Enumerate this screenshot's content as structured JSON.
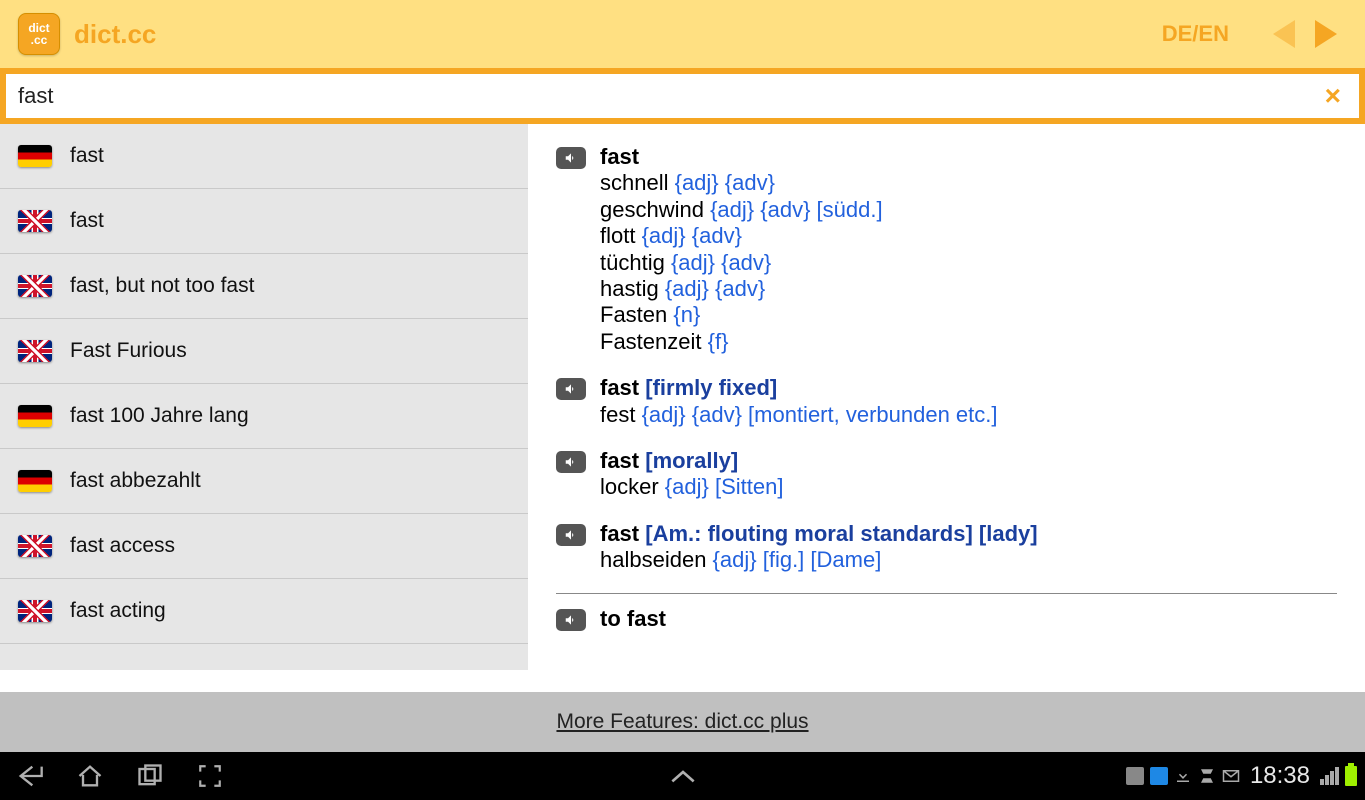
{
  "header": {
    "app_icon_text": "dict\n.cc",
    "app_title": "dict.cc",
    "lang_label": "DE/EN"
  },
  "search": {
    "value": "fast",
    "clear_label": "×"
  },
  "suggestions": [
    {
      "flag": "de",
      "text": "fast"
    },
    {
      "flag": "en",
      "text": "fast"
    },
    {
      "flag": "en",
      "text": "fast, but not too fast"
    },
    {
      "flag": "en",
      "text": "Fast  Furious"
    },
    {
      "flag": "de",
      "text": "fast 100 Jahre lang"
    },
    {
      "flag": "de",
      "text": "fast abbezahlt"
    },
    {
      "flag": "en",
      "text": "fast access"
    },
    {
      "flag": "en",
      "text": "fast acting"
    }
  ],
  "results": [
    {
      "head": "fast",
      "qual": "",
      "translations": [
        {
          "word": "schnell",
          "gram": "{adj} {adv}",
          "note": ""
        },
        {
          "word": "geschwind",
          "gram": "{adj} {adv}",
          "note": "[südd.]"
        },
        {
          "word": "flott",
          "gram": "{adj} {adv}",
          "note": ""
        },
        {
          "word": "tüchtig",
          "gram": "{adj} {adv}",
          "note": ""
        },
        {
          "word": "hastig",
          "gram": "{adj} {adv}",
          "note": ""
        },
        {
          "word": "Fasten",
          "gram": "{n}",
          "note": ""
        },
        {
          "word": "Fastenzeit",
          "gram": "{f}",
          "note": ""
        }
      ]
    },
    {
      "head": "fast",
      "qual": " [firmly fixed]",
      "translations": [
        {
          "word": "fest",
          "gram": "{adj} {adv}",
          "note": "[montiert, verbunden etc.]"
        }
      ]
    },
    {
      "head": "fast",
      "qual": " [morally]",
      "translations": [
        {
          "word": "locker",
          "gram": "{adj}",
          "note": "[Sitten]"
        }
      ]
    },
    {
      "head": "fast",
      "qual": " [Am.: flouting moral standards] [lady]",
      "translations": [
        {
          "word": "halbseiden",
          "gram": "{adj}",
          "note": "[fig.] [Dame]"
        }
      ]
    },
    {
      "head": "to fast",
      "qual": "",
      "translations": []
    }
  ],
  "promo": {
    "text": "More Features: dict.cc plus"
  },
  "statusbar": {
    "time": "18:38"
  }
}
